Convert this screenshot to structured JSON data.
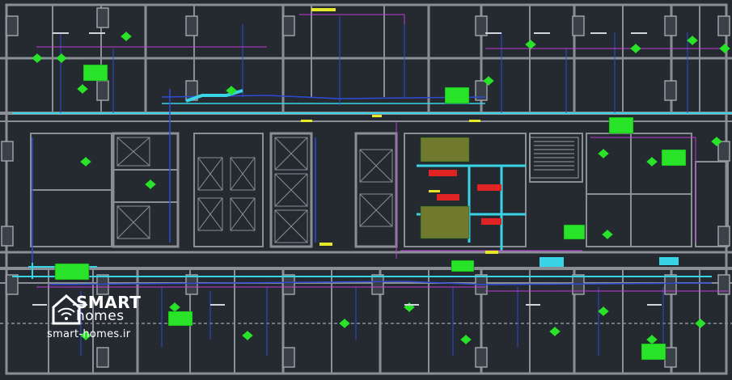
{
  "watermark": {
    "line1": "SMART",
    "line2": "homes",
    "url": "smart-homes.ir"
  },
  "colors": {
    "background": "#252a31",
    "walls": "#8a8f96",
    "duct_cyan": "#39d3e6",
    "duct_blue": "#2f4bd6",
    "magenta": "#c43bd6",
    "green_tag": "#29e329",
    "yellow_tag": "#e8e82a",
    "red_tag": "#e02424"
  }
}
